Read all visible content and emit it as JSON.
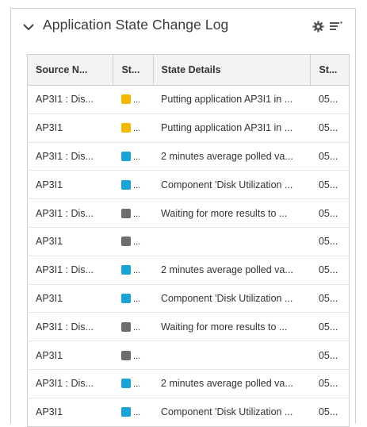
{
  "panel": {
    "title": "Application State Change Log"
  },
  "colors": {
    "yellow": "#f5b800",
    "blue": "#1aa3d6",
    "gray": "#6d6d6d"
  },
  "table": {
    "columns": [
      "Source N...",
      "St...",
      "State Details",
      "St..."
    ],
    "rows": [
      {
        "source": "AP3I1 : Dis...",
        "state": "yellow",
        "state_text": "...",
        "details": "Putting application AP3I1 in ...",
        "start": "05..."
      },
      {
        "source": "AP3I1",
        "state": "yellow",
        "state_text": "...",
        "details": "Putting application AP3I1 in ...",
        "start": "05..."
      },
      {
        "source": "AP3I1 : Dis...",
        "state": "blue",
        "state_text": "...",
        "details": "2 minutes average polled va...",
        "start": "05..."
      },
      {
        "source": "AP3I1",
        "state": "blue",
        "state_text": "...",
        "details": "Component 'Disk Utilization ...",
        "start": "05..."
      },
      {
        "source": "AP3I1 : Dis...",
        "state": "gray",
        "state_text": "...",
        "details": "Waiting for more results to ...",
        "start": "05..."
      },
      {
        "source": "AP3I1",
        "state": "gray",
        "state_text": "...",
        "details": "",
        "start": "05..."
      },
      {
        "source": "AP3I1 : Dis...",
        "state": "blue",
        "state_text": "...",
        "details": "2 minutes average polled va...",
        "start": "05..."
      },
      {
        "source": "AP3I1",
        "state": "blue",
        "state_text": "...",
        "details": "Component 'Disk Utilization ...",
        "start": "05..."
      },
      {
        "source": "AP3I1 : Dis...",
        "state": "gray",
        "state_text": "...",
        "details": "Waiting for more results to ...",
        "start": "05..."
      },
      {
        "source": "AP3I1",
        "state": "gray",
        "state_text": "...",
        "details": "",
        "start": "05..."
      },
      {
        "source": "AP3I1 : Dis...",
        "state": "blue",
        "state_text": "...",
        "details": "2 minutes average polled va...",
        "start": "05..."
      },
      {
        "source": "AP3I1",
        "state": "blue",
        "state_text": "...",
        "details": "Component 'Disk Utilization ...",
        "start": "05..."
      }
    ]
  }
}
